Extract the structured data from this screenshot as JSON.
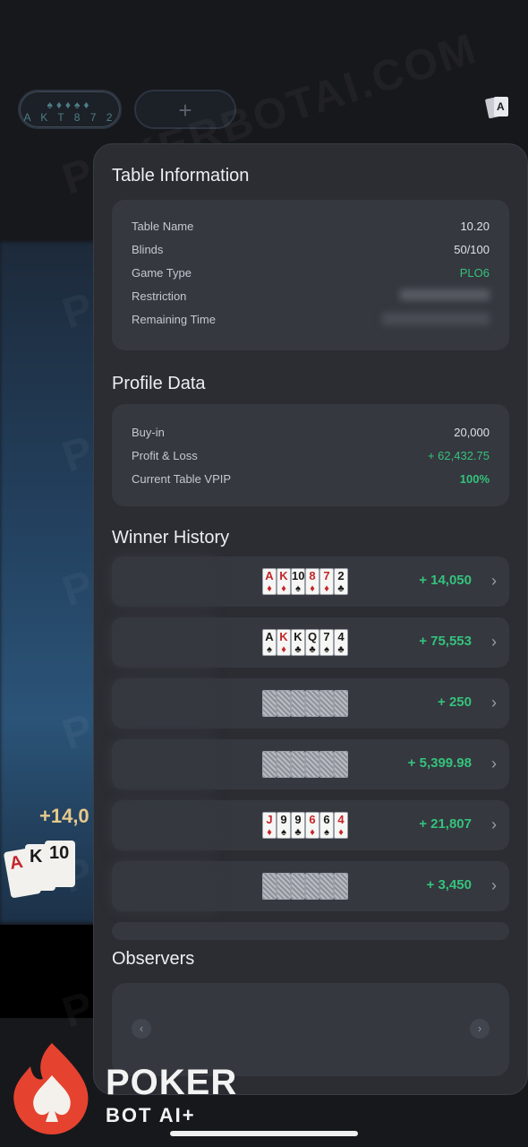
{
  "background": {
    "hand_pill": {
      "suits": "♠♦♦♠♦",
      "ranks": "A K T 8 7 2"
    },
    "add_label": "+",
    "amount": "+14,0"
  },
  "table_info": {
    "title": "Table Information",
    "rows": [
      {
        "label": "Table Name",
        "value": "10.20"
      },
      {
        "label": "Blinds",
        "value": "50/100"
      },
      {
        "label": "Game Type",
        "value": "PLO6"
      },
      {
        "label": "Restriction",
        "value": ""
      },
      {
        "label": "Remaining Time",
        "value": ""
      }
    ]
  },
  "profile": {
    "title": "Profile Data",
    "rows": [
      {
        "label": "Buy-in",
        "value": "20,000"
      },
      {
        "label": "Profit & Loss",
        "value": "+ 62,432.75"
      },
      {
        "label": "Current Table VPIP",
        "value": "100%"
      }
    ]
  },
  "winner_history": {
    "title": "Winner History",
    "rows": [
      {
        "amount": "+ 14,050",
        "cards": [
          {
            "r": "A",
            "s": "♦"
          },
          {
            "r": "K",
            "s": "♦"
          },
          {
            "r": "10",
            "s": "♠"
          },
          {
            "r": "8",
            "s": "♦"
          },
          {
            "r": "7",
            "s": "♦"
          },
          {
            "r": "2",
            "s": "♣"
          }
        ]
      },
      {
        "amount": "+ 75,553",
        "cards": [
          {
            "r": "A",
            "s": "♠"
          },
          {
            "r": "K",
            "s": "♦"
          },
          {
            "r": "K",
            "s": "♣"
          },
          {
            "r": "Q",
            "s": "♣"
          },
          {
            "r": "7",
            "s": "♠"
          },
          {
            "r": "4",
            "s": "♣"
          }
        ]
      },
      {
        "amount": "+ 250",
        "cards": []
      },
      {
        "amount": "+ 5,399.98",
        "cards": []
      },
      {
        "amount": "+ 21,807",
        "cards": [
          {
            "r": "J",
            "s": "♦"
          },
          {
            "r": "9",
            "s": "♠"
          },
          {
            "r": "9",
            "s": "♣"
          },
          {
            "r": "6",
            "s": "♦"
          },
          {
            "r": "6",
            "s": "♠"
          },
          {
            "r": "4",
            "s": "♦"
          }
        ]
      },
      {
        "amount": "+ 3,450",
        "cards": []
      }
    ]
  },
  "observers": {
    "title": "Observers",
    "prev": "‹",
    "next": "›"
  },
  "watermark": "POKERBOTAI.COM",
  "logo": {
    "line1": "POKER",
    "line2": "BOT AI+"
  }
}
